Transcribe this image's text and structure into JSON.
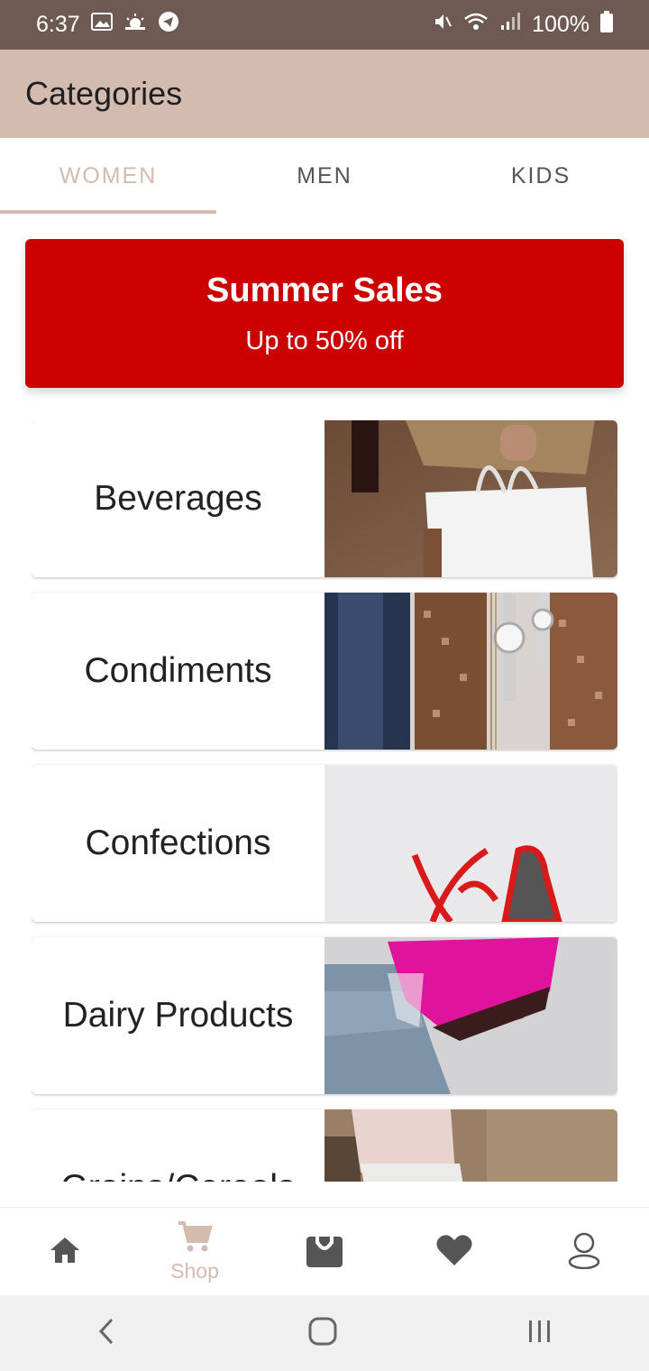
{
  "status_bar": {
    "time": "6:37",
    "battery": "100%"
  },
  "app_bar": {
    "title": "Categories"
  },
  "tabs": [
    {
      "label": "WOMEN",
      "active": true
    },
    {
      "label": "MEN",
      "active": false
    },
    {
      "label": "KIDS",
      "active": false
    }
  ],
  "banner": {
    "title": "Summer Sales",
    "subtitle": "Up to 50% off",
    "color": "#cc0000"
  },
  "categories": [
    {
      "label": "Beverages",
      "image": "shopping-bag-photo"
    },
    {
      "label": "Condiments",
      "image": "watches-sequins-photo"
    },
    {
      "label": "Confections",
      "image": "red-sunglasses-photo"
    },
    {
      "label": "Dairy Products",
      "image": "pink-boots-jeans-photo"
    },
    {
      "label": "Grains/Cereals",
      "image": "sneakers-photo"
    }
  ],
  "bottom_nav": [
    {
      "icon": "home-icon",
      "label": ""
    },
    {
      "icon": "cart-icon",
      "label": "Shop",
      "active": true
    },
    {
      "icon": "bag-icon",
      "label": ""
    },
    {
      "icon": "heart-icon",
      "label": ""
    },
    {
      "icon": "profile-icon",
      "label": ""
    }
  ],
  "colors": {
    "accent": "#d4bbb0",
    "status_bar": "#6e5a53"
  }
}
